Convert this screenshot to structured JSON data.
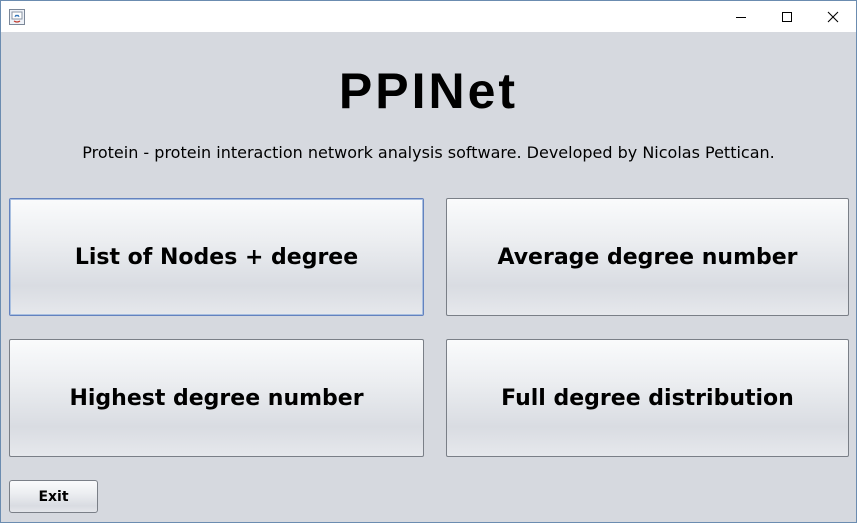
{
  "window": {
    "app_icon": "java-app-icon",
    "controls": {
      "minimize_icon": "minimize-icon",
      "maximize_icon": "maximize-icon",
      "close_icon": "close-icon"
    }
  },
  "header": {
    "title": "PPINet",
    "subtitle": "Protein - protein interaction network analysis software. Developed by Nicolas Pettican."
  },
  "buttons": {
    "list_nodes": "List of Nodes + degree",
    "average_degree": "Average degree number",
    "highest_degree": "Highest degree number",
    "full_distribution": "Full degree distribution",
    "exit": "Exit"
  },
  "colors": {
    "background": "#d6d9df",
    "titlebar": "#ffffff",
    "focus_border": "#6382bf"
  }
}
